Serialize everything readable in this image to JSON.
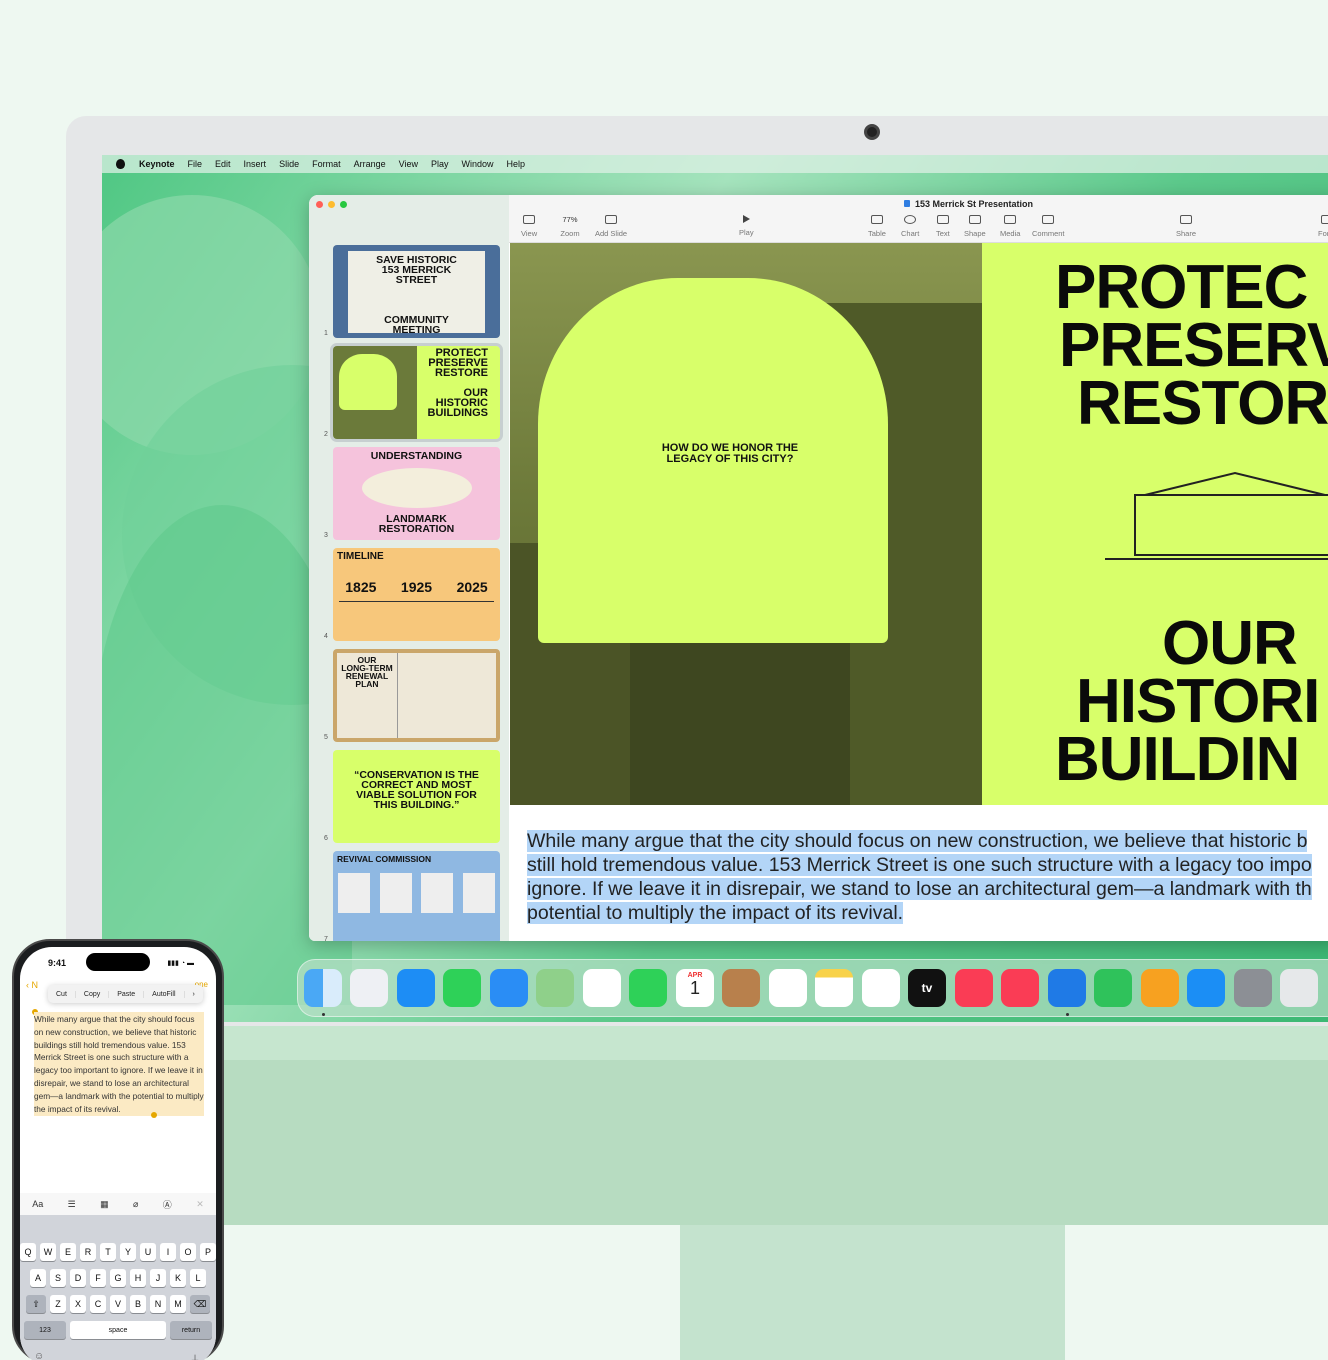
{
  "menubar": {
    "app": "Keynote",
    "items": [
      "File",
      "Edit",
      "Insert",
      "Slide",
      "Format",
      "Arrange",
      "View",
      "Play",
      "Window",
      "Help"
    ]
  },
  "window": {
    "title": "153 Merrick St Presentation"
  },
  "toolbar": {
    "view": "View",
    "zoom": "Zoom",
    "zoom_value": "77%",
    "add_slide": "Add Slide",
    "play": "Play",
    "table": "Table",
    "chart": "Chart",
    "text": "Text",
    "shape": "Shape",
    "media": "Media",
    "comment": "Comment",
    "share": "Share",
    "format": "Form"
  },
  "slides": {
    "s1": {
      "num": "1",
      "line1": "SAVE HISTORIC",
      "line2": "153 MERRICK",
      "line3": "STREET",
      "line4": "COMMUNITY",
      "line5": "MEETING"
    },
    "s2": {
      "num": "2",
      "line1": "PROTECT",
      "line2": "PRESERVE",
      "line3": "RESTORE",
      "line4": "OUR",
      "line5": "HISTORIC",
      "line6": "BUILDINGS"
    },
    "s3": {
      "num": "3",
      "line1": "UNDERSTANDING",
      "line2": "LANDMARK",
      "line3": "RESTORATION"
    },
    "s4": {
      "num": "4",
      "title": "TIMELINE",
      "y1": "1825",
      "y2": "1925",
      "y3": "2025"
    },
    "s5": {
      "num": "5",
      "line1": "OUR",
      "line2": "LONG-TERM",
      "line3": "RENEWAL",
      "line4": "PLAN"
    },
    "s6": {
      "num": "6",
      "quote": "“CONSERVATION IS THE CORRECT AND MOST VIABLE SOLUTION FOR THIS BUILDING.”"
    },
    "s7": {
      "num": "7",
      "title": "REVIVAL COMMISSION"
    }
  },
  "main_slide": {
    "question": "HOW DO WE HONOR THE LEGACY OF THIS CITY?",
    "l1": "PROTEC",
    "l2": "PRESERV",
    "l3": "RESTOR",
    "l4": "OUR",
    "l5": "HISTORI",
    "l6": "BUILDIN"
  },
  "notes": "While many argue that the city should focus on new construction, we believe that historic b still hold tremendous value. 153 Merrick Street is one such structure with a legacy too impo ignore. If we leave it in disrepair, we stand to lose an architectural gem—a landmark with th potential to multiply the impact of its revival.",
  "dock": {
    "calendar_month": "APR",
    "calendar_day": "1",
    "tv_label": "tv"
  },
  "phone": {
    "time": "9:41",
    "back": "N",
    "done": "one",
    "edit_menu": [
      "Cut",
      "Copy",
      "Paste",
      "AutoFill"
    ],
    "text": "While many argue that the city should focus on new construction, we believe that historic buildings still hold tremendous value. 153 Merrick Street is one such structure with a legacy too important to ignore. If we leave it in disrepair, we stand to lose an architectural gem—a landmark with the potential to multiply the impact of its revival.",
    "format_aa": "Aa",
    "row1": [
      "Q",
      "W",
      "E",
      "R",
      "T",
      "Y",
      "U",
      "I",
      "O",
      "P"
    ],
    "row2": [
      "A",
      "S",
      "D",
      "F",
      "G",
      "H",
      "J",
      "K",
      "L"
    ],
    "row3": [
      "Z",
      "X",
      "C",
      "V",
      "B",
      "N",
      "M"
    ],
    "key_123": "123",
    "key_space": "space",
    "key_return": "return"
  }
}
